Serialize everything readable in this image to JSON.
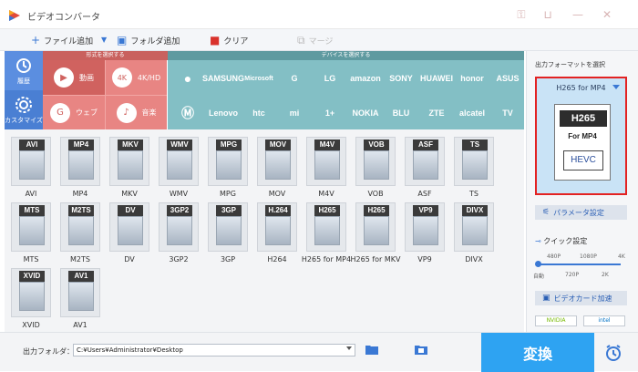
{
  "app": {
    "title": "ビデオコンバータ"
  },
  "window_controls": [
    {
      "icon": "key-icon",
      "glyph": "⚿"
    },
    {
      "icon": "cart-icon",
      "glyph": "⊔"
    },
    {
      "icon": "minimize-icon",
      "glyph": "—"
    },
    {
      "icon": "close-icon",
      "glyph": "✕"
    }
  ],
  "toolbar": {
    "add_file": "ファイル追加",
    "add_folder": "フォルダ追加",
    "clear": "クリア",
    "merge": "マージ"
  },
  "side_tabs": [
    {
      "label": "履歴",
      "icon": "history-icon"
    },
    {
      "label": "カスタマイズ",
      "icon": "customize-icon"
    }
  ],
  "categories": {
    "format_header": "形式を選択する",
    "device_header": "デバイスを選択する",
    "format_items": [
      {
        "label": "動画",
        "glyph": "▶"
      },
      {
        "label": "4K/HD",
        "glyph": "4K"
      },
      {
        "label": "ウェブ",
        "glyph": "G"
      },
      {
        "label": "音楽",
        "glyph": "♪"
      }
    ],
    "devices_row1": [
      "",
      "SAMSUNG",
      "Microsoft",
      "G",
      "LG",
      "amazon",
      "SONY",
      "HUAWEI",
      "honor",
      "ASUS"
    ],
    "devices_row2": [
      "",
      "Lenovo",
      "htc",
      "mi",
      "1+",
      "NOKIA",
      "BLU",
      "ZTE",
      "alcatel",
      "TV"
    ]
  },
  "formats": [
    {
      "cap": "AVI",
      "label": "AVI"
    },
    {
      "cap": "MP4",
      "label": "MP4"
    },
    {
      "cap": "MKV",
      "label": "MKV"
    },
    {
      "cap": "WMV",
      "label": "WMV"
    },
    {
      "cap": "MPG",
      "label": "MPG"
    },
    {
      "cap": "MOV",
      "label": "MOV"
    },
    {
      "cap": "M4V",
      "label": "M4V"
    },
    {
      "cap": "VOB",
      "label": "VOB"
    },
    {
      "cap": "ASF",
      "label": "ASF"
    },
    {
      "cap": "TS",
      "label": "TS"
    },
    {
      "cap": "MTS",
      "label": "MTS"
    },
    {
      "cap": "M2TS",
      "label": "M2TS"
    },
    {
      "cap": "DV",
      "label": "DV"
    },
    {
      "cap": "3GP2",
      "label": "3GP2"
    },
    {
      "cap": "3GP",
      "label": "3GP"
    },
    {
      "cap": "H.264",
      "label": "H264"
    },
    {
      "cap": "H265",
      "label": "H265 for MP4"
    },
    {
      "cap": "H265",
      "label": "H265 for MKV"
    },
    {
      "cap": "VP9",
      "label": "VP9"
    },
    {
      "cap": "DIVX",
      "label": "DIVX"
    },
    {
      "cap": "XVID",
      "label": "XVID"
    },
    {
      "cap": "AV1",
      "label": "AV1"
    }
  ],
  "right_panel": {
    "title": "出力フォーマットを選択",
    "selected_format": "H265 for MP4",
    "card_codec": "H265",
    "card_sub": "For MP4",
    "card_badge": "HEVC",
    "param_button": "パラメータ設定",
    "quick_setting": "クイック設定",
    "quality_ticks_top": [
      "480P",
      "1080P",
      "4K"
    ],
    "quality_ticks_bottom": [
      "自動",
      "720P",
      "2K"
    ],
    "gpu_button": "ビデオカード加速",
    "gpu_badges": [
      "NVIDIA",
      "intel"
    ]
  },
  "bottom": {
    "output_label": "出力フォルダ：",
    "output_path": "C:¥Users¥Administrator¥Desktop",
    "convert_label": "変換"
  }
}
